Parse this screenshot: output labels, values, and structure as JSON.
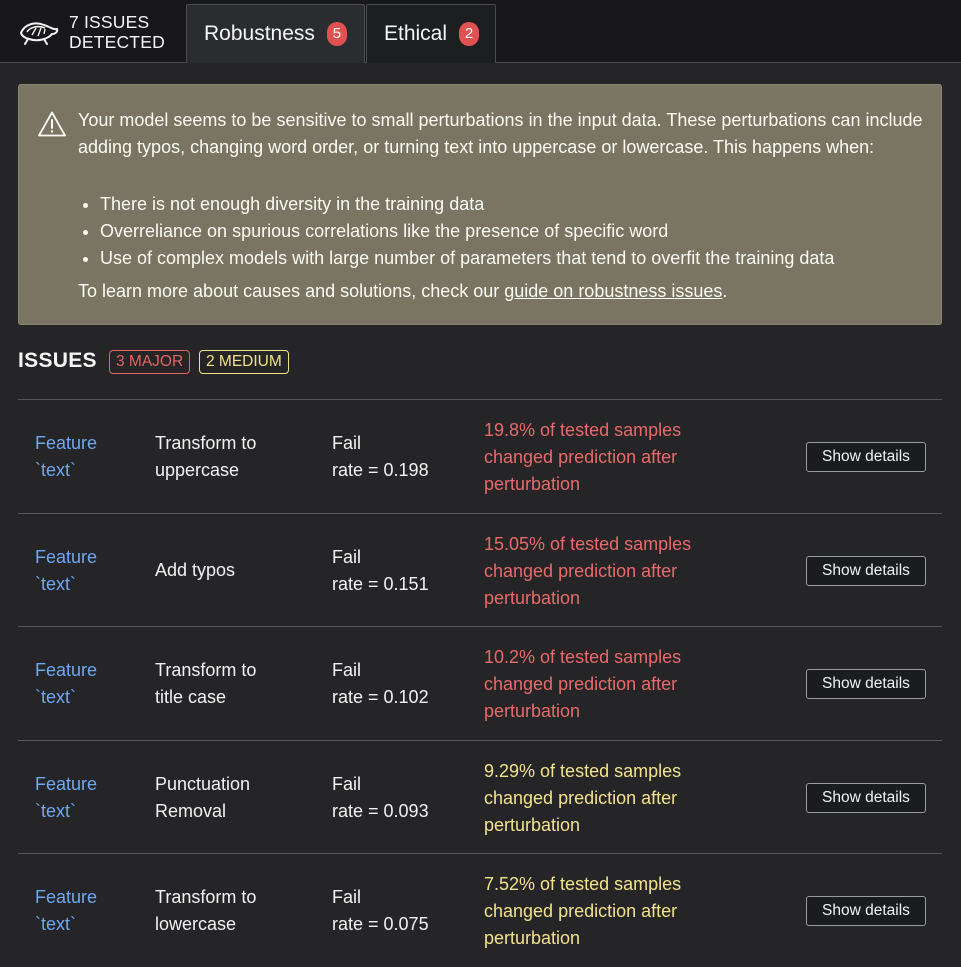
{
  "header": {
    "brand_line1": "7 ISSUES",
    "brand_line2": "DETECTED",
    "logo_icon": "turtle-logo-icon",
    "tabs": [
      {
        "label": "Robustness",
        "count": "5",
        "active": true
      },
      {
        "label": "Ethical",
        "count": "2",
        "active": false
      }
    ]
  },
  "warning": {
    "icon": "warning-triangle-icon",
    "intro": "Your model seems to be sensitive to small perturbations in the input data. These perturbations can include adding typos, changing word order, or turning text into uppercase or lowercase. This happens when:",
    "bullets": [
      "There is not enough diversity in the training data",
      "Overreliance on spurious correlations like the presence of specific word",
      "Use of complex models with large number of parameters that tend to overfit the training data"
    ],
    "outro_prefix": "To learn more about causes and solutions, check our ",
    "link_text": "guide on robustness issues",
    "outro_suffix": "."
  },
  "issues": {
    "title": "ISSUES",
    "major_badge": "3 MAJOR",
    "medium_badge": "2 MEDIUM",
    "colors": {
      "major": "#e86a6a",
      "medium": "#f3e28c",
      "feature": "#6fa8f2"
    },
    "rows": [
      {
        "feature_line1": "Feature",
        "feature_line2": "`text`",
        "transform_line1": "Transform to",
        "transform_line2": "uppercase",
        "rate_line1": "Fail",
        "rate_line2": "rate = 0.198",
        "desc_line1": "19.8% of tested samples",
        "desc_line2": "changed prediction after",
        "desc_line3": "perturbation",
        "severity": "major",
        "button": "Show details"
      },
      {
        "feature_line1": "Feature",
        "feature_line2": "`text`",
        "transform_line1": "Add typos",
        "transform_line2": "",
        "rate_line1": "Fail",
        "rate_line2": "rate = 0.151",
        "desc_line1": "15.05% of tested samples",
        "desc_line2": "changed prediction after",
        "desc_line3": "perturbation",
        "severity": "major",
        "button": "Show details"
      },
      {
        "feature_line1": "Feature",
        "feature_line2": "`text`",
        "transform_line1": "Transform to",
        "transform_line2": "title case",
        "rate_line1": "Fail",
        "rate_line2": "rate = 0.102",
        "desc_line1": "10.2% of tested samples",
        "desc_line2": "changed prediction after",
        "desc_line3": "perturbation",
        "severity": "major",
        "button": "Show details"
      },
      {
        "feature_line1": "Feature",
        "feature_line2": "`text`",
        "transform_line1": "Punctuation",
        "transform_line2": "Removal",
        "rate_line1": "Fail",
        "rate_line2": "rate = 0.093",
        "desc_line1": "9.29% of tested samples",
        "desc_line2": "changed prediction after",
        "desc_line3": "perturbation",
        "severity": "medium",
        "button": "Show details"
      },
      {
        "feature_line1": "Feature",
        "feature_line2": "`text`",
        "transform_line1": "Transform to",
        "transform_line2": "lowercase",
        "rate_line1": "Fail",
        "rate_line2": "rate = 0.075",
        "desc_line1": "7.52% of tested samples",
        "desc_line2": "changed prediction after",
        "desc_line3": "perturbation",
        "severity": "medium",
        "button": "Show details"
      }
    ]
  }
}
